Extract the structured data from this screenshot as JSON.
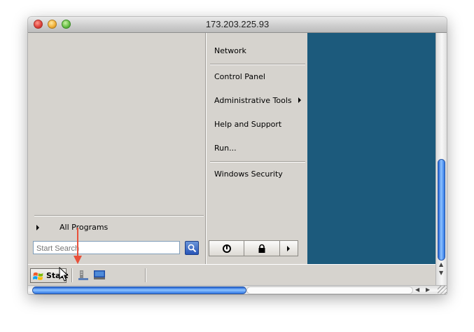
{
  "window": {
    "title": "173.203.225.93"
  },
  "start_menu": {
    "right_items": {
      "network": "Network",
      "control_panel": "Control Panel",
      "admin_tools": "Administrative Tools",
      "help_support": "Help and Support",
      "run": "Run...",
      "windows_security": "Windows Security"
    },
    "all_programs": "All Programs",
    "search": {
      "placeholder": "Start Search"
    }
  },
  "taskbar": {
    "start_label": "Start"
  },
  "colors": {
    "desktop_bg": "#1c5a7c",
    "menu_bg": "#d6d3ce",
    "annotation_arrow": "#e8503a",
    "scroll_thumb": "#3a7fe0"
  },
  "icons": [
    "search-icon",
    "power-icon",
    "lock-icon",
    "arrow-right-icon",
    "windows-flag-icon",
    "server-manager-icon",
    "show-desktop-icon",
    "mouse-cursor-icon"
  ]
}
